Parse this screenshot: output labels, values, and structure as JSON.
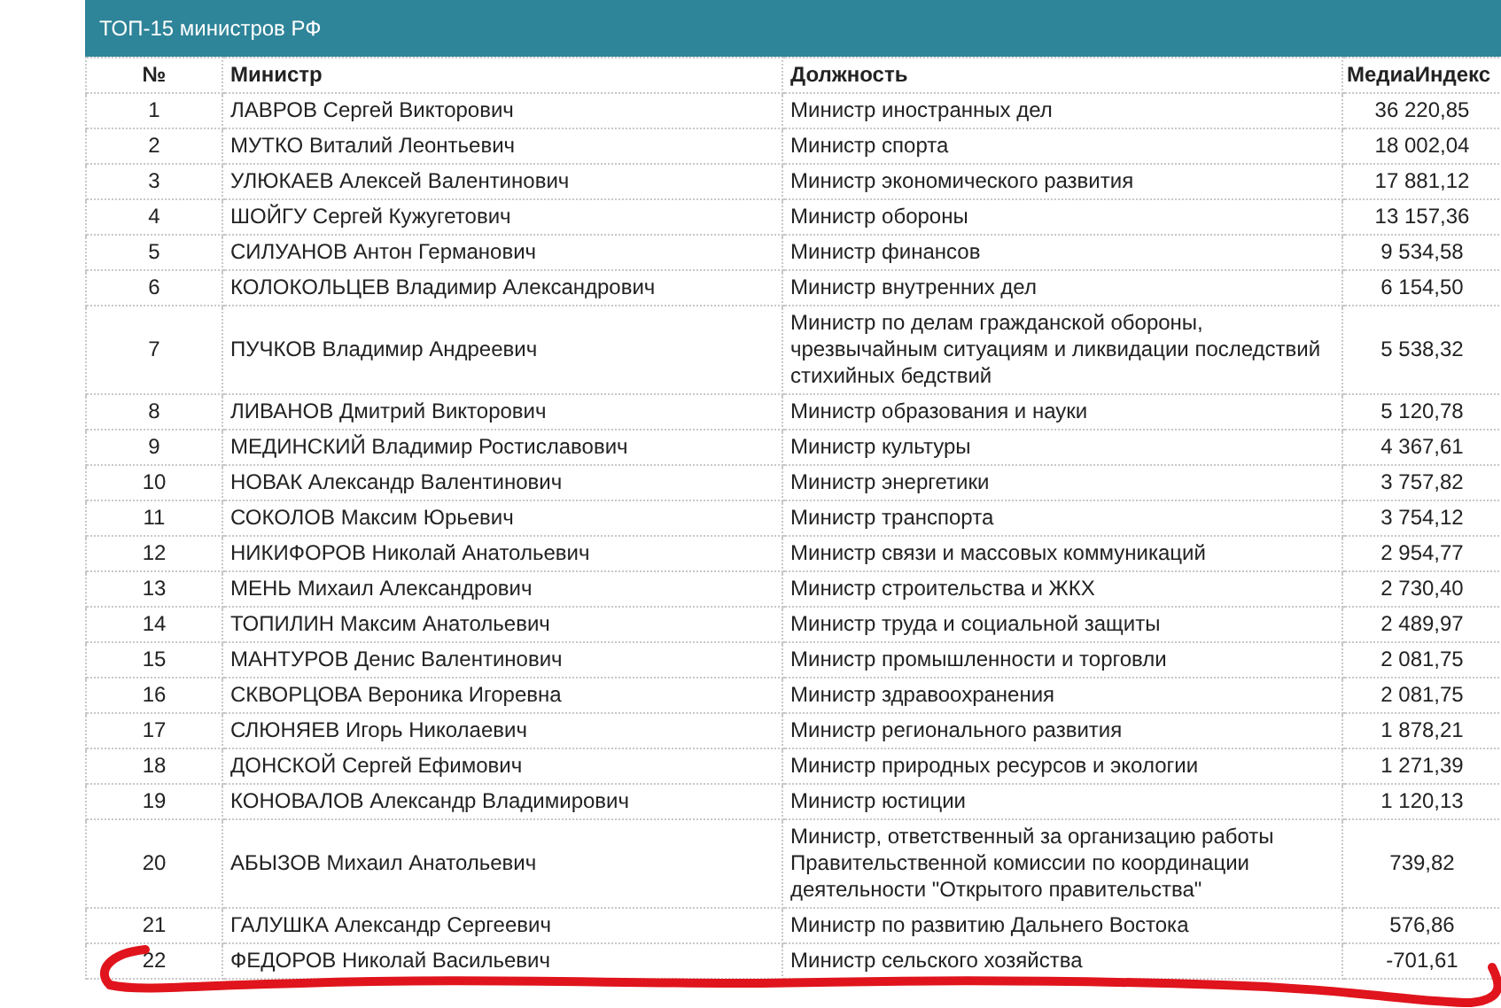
{
  "table": {
    "title": "ТОП-15 министров РФ",
    "columns": [
      "№",
      "Министр",
      "Должность",
      "МедиаИндекс"
    ],
    "rows": [
      [
        "1",
        "ЛАВРОВ Сергей Викторович",
        "Министр иностранных дел",
        "36 220,85"
      ],
      [
        "2",
        "МУТКО Виталий Леонтьевич",
        "Министр спорта",
        "18 002,04"
      ],
      [
        "3",
        "УЛЮКАЕВ Алексей Валентинович",
        "Министр экономического развития",
        "17 881,12"
      ],
      [
        "4",
        "ШОЙГУ Сергей Кужугетович",
        "Министр обороны",
        "13 157,36"
      ],
      [
        "5",
        "СИЛУАНОВ Антон Германович",
        "Министр финансов",
        "9 534,58"
      ],
      [
        "6",
        "КОЛОКОЛЬЦЕВ Владимир Александрович",
        "Министр внутренних дел",
        "6 154,50"
      ],
      [
        "7",
        "ПУЧКОВ Владимир Андреевич",
        "Министр по делам гражданской обороны, чрезвычайным ситуациям и ликвидации последствий стихийных бедствий",
        "5 538,32"
      ],
      [
        "8",
        "ЛИВАНОВ Дмитрий Викторович",
        "Министр образования и науки",
        "5 120,78"
      ],
      [
        "9",
        "МЕДИНСКИЙ Владимир Ростиславович",
        "Министр культуры",
        "4 367,61"
      ],
      [
        "10",
        "НОВАК Александр Валентинович",
        "Министр энергетики",
        "3 757,82"
      ],
      [
        "11",
        "СОКОЛОВ Максим Юрьевич",
        "Министр транспорта",
        "3 754,12"
      ],
      [
        "12",
        "НИКИФОРОВ Николай Анатольевич",
        "Министр связи и массовых коммуникаций",
        "2 954,77"
      ],
      [
        "13",
        "МЕНЬ Михаил Александрович",
        "Министр строительства и ЖКХ",
        "2 730,40"
      ],
      [
        "14",
        "ТОПИЛИН Максим Анатольевич",
        "Министр труда и социальной защиты",
        "2 489,97"
      ],
      [
        "15",
        "МАНТУРОВ Денис Валентинович",
        "Министр промышленности и торговли",
        "2 081,75"
      ],
      [
        "16",
        "СКВОРЦОВА Вероника Игоревна",
        "Министр здравоохранения",
        "2 081,75"
      ],
      [
        "17",
        "СЛЮНЯЕВ Игорь Николаевич",
        "Министр регионального развития",
        "1 878,21"
      ],
      [
        "18",
        "ДОНСКОЙ Сергей Ефимович",
        "Министр природных ресурсов и экологии",
        "1 271,39"
      ],
      [
        "19",
        "КОНОВАЛОВ Александр Владимирович",
        "Министр юстиции",
        "1 120,13"
      ],
      [
        "20",
        "АБЫЗОВ Михаил Анатольевич",
        "Министр, ответственный за организацию работы Правительственной комиссии по координации деятельности \"Открытого правительства\"",
        "739,82"
      ],
      [
        "21",
        "ГАЛУШКА Александр Сергеевич",
        "Министр по развитию Дальнего Востока",
        "576,86"
      ],
      [
        "22",
        "ФЕДОРОВ Николай Васильевич",
        "Министр сельского хозяйства",
        "-701,61"
      ]
    ]
  }
}
